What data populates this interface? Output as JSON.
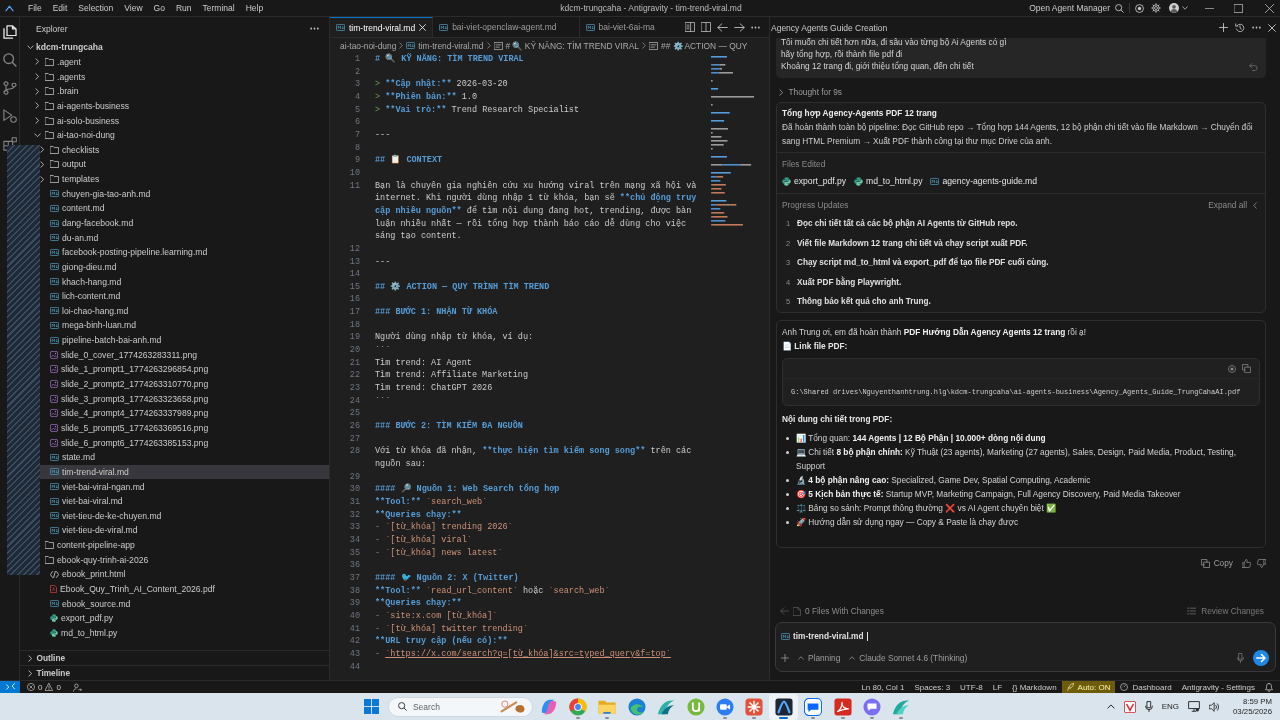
{
  "title_bar": {
    "menu": [
      "File",
      "Edit",
      "Selection",
      "View",
      "Go",
      "Run",
      "Terminal",
      "Help"
    ],
    "title": "kdcm-trungcaha - Antigravity - tim-trend-viral.md",
    "agent_manager": "Open Agent Manager"
  },
  "activity_bar": [
    {
      "selected": true
    },
    {
      "selected": false
    },
    {
      "selected": false
    },
    {
      "selected": false
    },
    {
      "selected": false
    }
  ],
  "sidebar": {
    "title": "Explorer",
    "tree": [
      {
        "label": "kdcm-trungcaha",
        "kind": "root",
        "expanded": true,
        "selected": false,
        "children": [
          {
            "label": ".agent",
            "kind": "folder",
            "expanded": false,
            "selected": false
          },
          {
            "label": ".agents",
            "kind": "folder",
            "expanded": false,
            "selected": false
          },
          {
            "label": ".brain",
            "kind": "folder",
            "expanded": false,
            "selected": false
          },
          {
            "label": "ai-agents-business",
            "kind": "folder",
            "expanded": false,
            "selected": false
          },
          {
            "label": "ai-solo-business",
            "kind": "folder",
            "expanded": false,
            "selected": false
          },
          {
            "label": "ai-tao-noi-dung",
            "kind": "folder",
            "expanded": true,
            "selected": false,
            "children": [
              {
                "label": "checklists",
                "kind": "folder",
                "expanded": false,
                "selected": false
              },
              {
                "label": "output",
                "kind": "folder",
                "expanded": false,
                "selected": false
              },
              {
                "label": "templates",
                "kind": "folder",
                "expanded": false,
                "selected": false
              },
              {
                "label": "chuyen-gia-tao-anh.md",
                "kind": "markdown",
                "selected": false
              },
              {
                "label": "content.md",
                "kind": "markdown",
                "selected": false
              },
              {
                "label": "dang-facebook.md",
                "kind": "markdown",
                "selected": false
              },
              {
                "label": "du-an.md",
                "kind": "markdown",
                "selected": false
              },
              {
                "label": "facebook-posting-pipeline.learning.md",
                "kind": "markdown",
                "selected": false
              },
              {
                "label": "giong-dieu.md",
                "kind": "markdown",
                "selected": false
              },
              {
                "label": "khach-hang.md",
                "kind": "markdown",
                "selected": false
              },
              {
                "label": "lich-content.md",
                "kind": "markdown",
                "selected": false
              },
              {
                "label": "loi-chao-hang.md",
                "kind": "markdown",
                "selected": false
              },
              {
                "label": "mega-binh-luan.md",
                "kind": "markdown",
                "selected": false
              },
              {
                "label": "pipeline-batch-bai-anh.md",
                "kind": "markdown",
                "selected": false
              },
              {
                "label": "slide_0_cover_1774263283311.png",
                "kind": "image",
                "selected": false
              },
              {
                "label": "slide_1_prompt1_1774263296854.png",
                "kind": "image",
                "selected": false
              },
              {
                "label": "slide_2_prompt2_1774263310770.png",
                "kind": "image",
                "selected": false
              },
              {
                "label": "slide_3_prompt3_1774263323658.png",
                "kind": "image",
                "selected": false
              },
              {
                "label": "slide_4_prompt4_1774263337989.png",
                "kind": "image",
                "selected": false
              },
              {
                "label": "slide_5_prompt5_1774263369516.png",
                "kind": "image",
                "selected": false
              },
              {
                "label": "slide_6_prompt6_1774263385153.png",
                "kind": "image",
                "selected": false
              },
              {
                "label": "state.md",
                "kind": "markdown",
                "selected": false
              },
              {
                "label": "tim-trend-viral.md",
                "kind": "markdown",
                "selected": true
              },
              {
                "label": "viet-bai-viral-ngan.md",
                "kind": "markdown",
                "selected": false
              },
              {
                "label": "viet-bai-viral.md",
                "kind": "markdown",
                "selected": false
              },
              {
                "label": "viet-tieu-de-ke-chuyen.md",
                "kind": "markdown",
                "selected": false
              },
              {
                "label": "viet-tieu-de-viral.md",
                "kind": "markdown",
                "selected": false
              }
            ]
          },
          {
            "label": "content-pipeline-app",
            "kind": "folder",
            "selected": false
          },
          {
            "label": "ebook-quy-trinh-ai-2026",
            "kind": "folder",
            "selected": false,
            "children": [
              {
                "label": "ebook_print.html",
                "kind": "html",
                "selected": false
              },
              {
                "label": "Ebook_Quy_Trinh_AI_Content_2026.pdf",
                "kind": "pdf",
                "selected": false
              },
              {
                "label": "ebook_source.md",
                "kind": "markdown",
                "selected": false
              },
              {
                "label": "export_pdf.py",
                "kind": "python",
                "selected": false
              },
              {
                "label": "md_to_html.py",
                "kind": "python",
                "selected": false
              }
            ]
          }
        ]
      }
    ],
    "sections": [
      {
        "label": "Outline",
        "expanded": false
      },
      {
        "label": "Timeline",
        "expanded": false
      }
    ]
  },
  "editor": {
    "tabs": [
      {
        "label": "tim-trend-viral.md",
        "selected": true
      },
      {
        "label": "bai-viet-openclaw-agent.md",
        "selected": false
      },
      {
        "label": "bai-viet-6ai-ma",
        "selected": false
      }
    ],
    "breadcrumb": [
      {
        "label": "ai-tao-noi-dung",
        "kind": "folder"
      },
      {
        "label": "tim-trend-viral.md",
        "kind": "markdown"
      },
      {
        "label": "# 🔍 KỸ NĂNG: TÌM TREND VIRAL",
        "kind": "symbol"
      },
      {
        "label": "## ⚙️ ACTION — QUY",
        "kind": "symbol"
      }
    ],
    "lines": [
      {
        "number": "1",
        "segments": [
          {
            "kind": "heading",
            "text": "# 🔍 KỸ NĂNG: TÌM TREND VIRAL"
          }
        ]
      },
      {
        "number": "2"
      },
      {
        "number": "3",
        "segments": [
          {
            "kind": "quote",
            "text": "> "
          },
          {
            "kind": "bold",
            "text": "**Cập nhật:**"
          },
          {
            "kind": "text",
            "text": " 2026-03-20"
          }
        ]
      },
      {
        "number": "4",
        "segments": [
          {
            "kind": "quote",
            "text": "> "
          },
          {
            "kind": "bold",
            "text": "**Phiên bản:**"
          },
          {
            "kind": "text",
            "text": " 1.0"
          }
        ]
      },
      {
        "number": "5",
        "segments": [
          {
            "kind": "quote",
            "text": "> "
          },
          {
            "kind": "bold",
            "text": "**Vai trò:**"
          },
          {
            "kind": "text",
            "text": " Trend Research Specialist"
          }
        ]
      },
      {
        "number": "6"
      },
      {
        "number": "7",
        "segments": [
          {
            "kind": "rule",
            "text": "---"
          }
        ]
      },
      {
        "number": "8"
      },
      {
        "number": "9",
        "segments": [
          {
            "kind": "heading",
            "text": "## 📋 CONTEXT"
          }
        ]
      },
      {
        "number": "10"
      },
      {
        "number": "11",
        "segments": [
          {
            "kind": "text",
            "text": "Bạn là chuyên gia nghiên cứu xu hướng viral trên mạng xã hội và internet. Khi người dùng nhập 1 từ khóa, bạn sẽ "
          },
          {
            "kind": "bold",
            "text": "**chủ động truy cập nhiều nguồn**"
          },
          {
            "kind": "text",
            "text": " để tìm nội dung đang hot, trending, được bàn luận nhiều nhất — rồi tổng hợp thành báo cáo dễ dùng cho việc sáng tạo content."
          }
        ]
      },
      {
        "number": "12"
      },
      {
        "number": "13",
        "segments": [
          {
            "kind": "rule",
            "text": "---"
          }
        ]
      },
      {
        "number": "14"
      },
      {
        "number": "15",
        "segments": [
          {
            "kind": "heading",
            "text": "## ⚙️ ACTION — QUY TRÌNH TÌM TREND"
          }
        ]
      },
      {
        "number": "16"
      },
      {
        "number": "17",
        "segments": [
          {
            "kind": "heading",
            "text": "### BƯỚC 1: NHẬN TỪ KHÓA"
          }
        ]
      },
      {
        "number": "18"
      },
      {
        "number": "19",
        "segments": [
          {
            "kind": "text",
            "text": "Người dùng nhập từ khóa, ví dụ:"
          }
        ]
      },
      {
        "number": "20",
        "segments": [
          {
            "kind": "rule",
            "text": "```"
          }
        ]
      },
      {
        "number": "21",
        "segments": [
          {
            "kind": "text",
            "text": "Tìm trend: AI Agent"
          }
        ]
      },
      {
        "number": "22",
        "segments": [
          {
            "kind": "text",
            "text": "Tìm trend: Affiliate Marketing"
          }
        ]
      },
      {
        "number": "23",
        "segments": [
          {
            "kind": "text",
            "text": "Tìm trend: ChatGPT 2026"
          }
        ]
      },
      {
        "number": "24",
        "segments": [
          {
            "kind": "rule",
            "text": "```"
          }
        ]
      },
      {
        "number": "25"
      },
      {
        "number": "26",
        "segments": [
          {
            "kind": "heading",
            "text": "### BƯỚC 2: TÌM KIẾM ĐA NGUỒN"
          }
        ]
      },
      {
        "number": "27"
      },
      {
        "number": "28",
        "segments": [
          {
            "kind": "text",
            "text": "Với từ khóa đã nhận, "
          },
          {
            "kind": "bold",
            "text": "**thực hiện tìm kiếm song song**"
          },
          {
            "kind": "text",
            "text": " trên các nguồn sau:"
          }
        ]
      },
      {
        "number": "29"
      },
      {
        "number": "30",
        "segments": [
          {
            "kind": "heading",
            "text": "#### 🔎 Nguồn 1: Web Search tổng hợp"
          }
        ]
      },
      {
        "number": "31",
        "segments": [
          {
            "kind": "bold",
            "text": "**Tool:** "
          },
          {
            "kind": "code",
            "text": "`search_web`"
          }
        ]
      },
      {
        "number": "32",
        "segments": [
          {
            "kind": "bold",
            "text": "**Queries chạy:**"
          }
        ]
      },
      {
        "number": "33",
        "segments": [
          {
            "kind": "marker",
            "text": "- "
          },
          {
            "kind": "code",
            "text": "`[từ_khóa] trending 2026`"
          }
        ]
      },
      {
        "number": "34",
        "segments": [
          {
            "kind": "marker",
            "text": "- "
          },
          {
            "kind": "code",
            "text": "`[từ_khóa] viral`"
          }
        ]
      },
      {
        "number": "35",
        "segments": [
          {
            "kind": "marker",
            "text": "- "
          },
          {
            "kind": "code",
            "text": "`[từ_khóa] news latest`"
          }
        ]
      },
      {
        "number": "36"
      },
      {
        "number": "37",
        "segments": [
          {
            "kind": "heading",
            "text": "#### 🐦 Nguồn 2: X (Twitter)"
          }
        ]
      },
      {
        "number": "38",
        "segments": [
          {
            "kind": "bold",
            "text": "**Tool:** "
          },
          {
            "kind": "code",
            "text": "`read_url_content`"
          },
          {
            "kind": "text",
            "text": " hoặc "
          },
          {
            "kind": "code",
            "text": "`search_web`"
          }
        ]
      },
      {
        "number": "39",
        "segments": [
          {
            "kind": "bold",
            "text": "**Queries chạy:**"
          }
        ]
      },
      {
        "number": "40",
        "segments": [
          {
            "kind": "marker",
            "text": "- "
          },
          {
            "kind": "code",
            "text": "`site:x.com [từ_khóa]`"
          }
        ]
      },
      {
        "number": "41",
        "segments": [
          {
            "kind": "marker",
            "text": "- "
          },
          {
            "kind": "code",
            "text": "`[từ_khóa] twitter trending`"
          }
        ]
      },
      {
        "number": "42",
        "segments": [
          {
            "kind": "bold",
            "text": "**URL truy cập (nếu có):**"
          }
        ]
      },
      {
        "number": "43",
        "segments": [
          {
            "kind": "marker",
            "text": "- "
          },
          {
            "kind": "link",
            "text": "`https://x.com/search?q=[từ_khóa]&src=typed_query&f=top`"
          }
        ]
      },
      {
        "number": "44"
      }
    ]
  },
  "agent_panel": {
    "title": "Agency Agents Guide Creation",
    "user_message": [
      "Tôi muốn chi tiết hơn nữa, đi sâu vào từng bộ Ai Agents có gì",
      "hãy tổng hợp, rồi thành file pdf đi",
      "Khoảng 12 trang đi, giới thiệu tổng quan, đến chi tiết"
    ],
    "thought": {
      "label": "Thought for 9s",
      "expanded": false
    },
    "task_card": {
      "title": "Tổng hợp Agency-Agents PDF 12 trang",
      "summary": "Đã hoàn thành toàn bộ pipeline: Đọc GitHub repo → Tổng hợp 144 Agents, 12 bộ phận chi tiết vào file Markdown → Chuyển đổi sang HTML Premium → Xuất PDF thành công tại thư mục Drive của anh.",
      "files_label": "Files Edited",
      "files": [
        {
          "name": "export_pdf.py",
          "kind": "python"
        },
        {
          "name": "md_to_html.py",
          "kind": "python"
        },
        {
          "name": "agency-agents-guide.md",
          "kind": "markdown"
        }
      ],
      "progress_label": "Progress Updates",
      "expand_all": "Expand all",
      "steps": [
        {
          "number": "1",
          "text": "Đọc chi tiết tất cả các bộ phận AI Agents từ GitHub repo."
        },
        {
          "number": "2",
          "text": "Viết file Markdown 12 trang chi tiết và chạy script xuất PDF."
        },
        {
          "number": "3",
          "text": "Chạy script md_to_html và export_pdf để tạo file PDF cuối cùng."
        },
        {
          "number": "4",
          "text": "Xuất PDF bằng Playwright."
        },
        {
          "number": "5",
          "text": "Thông báo kết quả cho anh Trung."
        }
      ]
    },
    "response": {
      "intro": "Anh Trung ơi, em đã hoàn thành **PDF Hướng Dẫn Agency Agents 12 trang** rồi ạ!",
      "link_label": "📄 Link file PDF:",
      "path": "G:\\Shared drives\\Nguyenthanhtrung.hlg\\kdcm-trungcaha\\ai-agents-business\\Agency_Agents_Guide_TrungCahaAI.pdf",
      "details_heading": "Nội dung chi tiết trong PDF:",
      "bullets": [
        "📊 Tổng quan: **144 Agents | 12 Bộ Phận | 10.000+ dòng nội dung**",
        "💻 Chi tiết **8 bộ phận chính:** Kỹ Thuật (23 agents), Marketing (27 agents), Sales, Design, Paid Media, Product, Testing, Support",
        "🔬 **4 bộ phận nâng cao:** Specialized, Game Dev, Spatial Computing, Academic",
        "🎯 **5 Kịch bản thực tế:** Startup MVP, Marketing Campaign, Full Agency Discovery, Paid Media Takeover",
        "⚖️ Bảng so sánh: Prompt thông thường ❌ vs AI Agent chuyên biệt ✅",
        "🚀 Hướng dẫn sử dụng ngay — Copy & Paste là chạy được"
      ],
      "copy_label": "Copy"
    },
    "changes": {
      "label": "0 Files With Changes",
      "review": "Review Changes"
    },
    "input": {
      "context_chip": "tim-trend-viral.md",
      "mode": "Planning",
      "model": "Claude Sonnet 4.6 (Thinking)"
    }
  },
  "status_bar": {
    "errors": "0",
    "warnings": "0",
    "items": [
      {
        "text": "Ln 80, Col 1",
        "kind": "plain"
      },
      {
        "text": "Spaces: 3",
        "kind": "plain"
      },
      {
        "text": "UTF-8",
        "kind": "plain"
      },
      {
        "text": "LF",
        "kind": "plain"
      },
      {
        "text": "{} Markdown",
        "kind": "plain"
      },
      {
        "text": "Auto: ON",
        "kind": "toggle"
      },
      {
        "text": "Dashboard",
        "kind": "dashboard"
      },
      {
        "text": "Antigravity - Settings",
        "kind": "plain"
      }
    ]
  },
  "taskbar": {
    "search": {
      "placeholder": "Search"
    },
    "apps": [
      {
        "running": false,
        "selected": false
      },
      {
        "running": true,
        "selected": false
      },
      {
        "running": true,
        "selected": false
      },
      {
        "running": false,
        "selected": false
      },
      {
        "running": false,
        "selected": false
      },
      {
        "running": false,
        "selected": false
      },
      {
        "running": true,
        "selected": false
      },
      {
        "running": true,
        "selected": false
      },
      {
        "running": true,
        "selected": true
      },
      {
        "running": true,
        "selected": false
      },
      {
        "running": true,
        "selected": false
      },
      {
        "running": true,
        "selected": false
      },
      {
        "running": true,
        "selected": false
      }
    ],
    "tray": {
      "language": "ENG",
      "time": "8:59 PM",
      "date": "03/25/2026"
    }
  }
}
